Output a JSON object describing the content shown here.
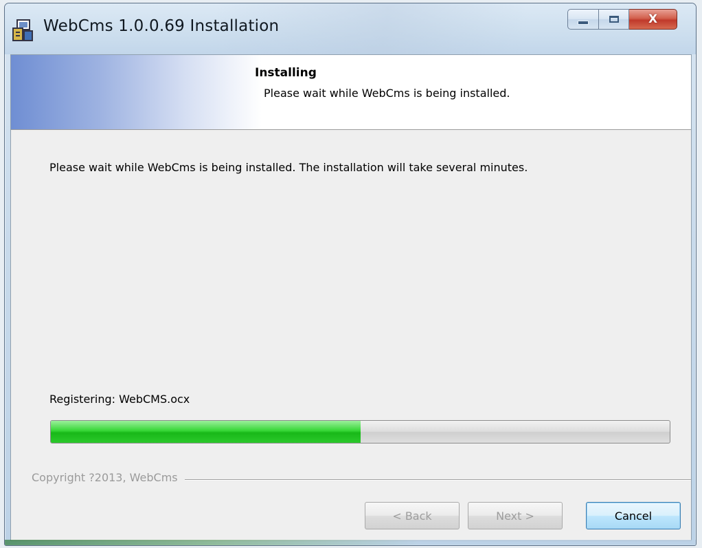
{
  "window": {
    "title": "WebCms 1.0.0.69 Installation",
    "icons": {
      "app": "installer-icon",
      "minimize": "minimize-icon",
      "maximize": "maximize-icon",
      "close": "close-icon"
    },
    "close_glyph": "X"
  },
  "banner": {
    "title": "Installing",
    "subtitle": "Please wait while WebCms is being installed."
  },
  "body": {
    "description": "Please wait while WebCms is being installed. The installation will take several minutes.",
    "status": "Registering: WebCMS.ocx",
    "progress_fraction": 0.5
  },
  "footer": {
    "copyright": "Copyright ?2013, WebCms",
    "buttons": {
      "back": "< Back",
      "next": "Next >",
      "cancel": "Cancel"
    }
  },
  "colors": {
    "progress_fill": "#22c422",
    "banner_gradient_start": "#6f8ed3",
    "close_button": "#c0392b"
  }
}
